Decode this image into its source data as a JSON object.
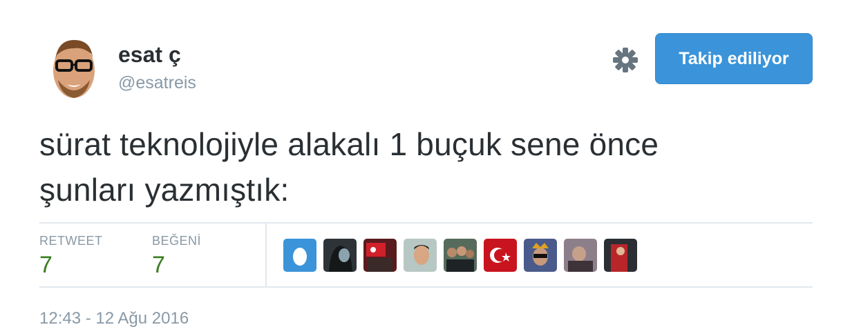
{
  "user": {
    "display_name": "esat ç",
    "handle": "@esatreis"
  },
  "header": {
    "settings_icon": "gear-icon",
    "follow_button_label": "Takip ediliyor",
    "accent_color": "#3b94d9"
  },
  "tweet": {
    "text_line1": "sürat teknolojiyle alakalı 1 buçuk sene önce",
    "text_line2": "şunları yazmıştık:"
  },
  "stats": {
    "retweet_label": "RETWEET",
    "retweet_count": "7",
    "like_label": "BEĞENİ",
    "like_count": "7",
    "count_color": "#3a7d1f"
  },
  "likers": [
    {
      "icon": "default-egg-avatar"
    },
    {
      "icon": "user-avatar"
    },
    {
      "icon": "user-avatar"
    },
    {
      "icon": "user-avatar"
    },
    {
      "icon": "user-avatar"
    },
    {
      "icon": "user-avatar"
    },
    {
      "icon": "user-avatar"
    },
    {
      "icon": "user-avatar"
    },
    {
      "icon": "user-avatar"
    }
  ],
  "meta": {
    "timestamp": "12:43 - 12 Ağu 2016"
  }
}
